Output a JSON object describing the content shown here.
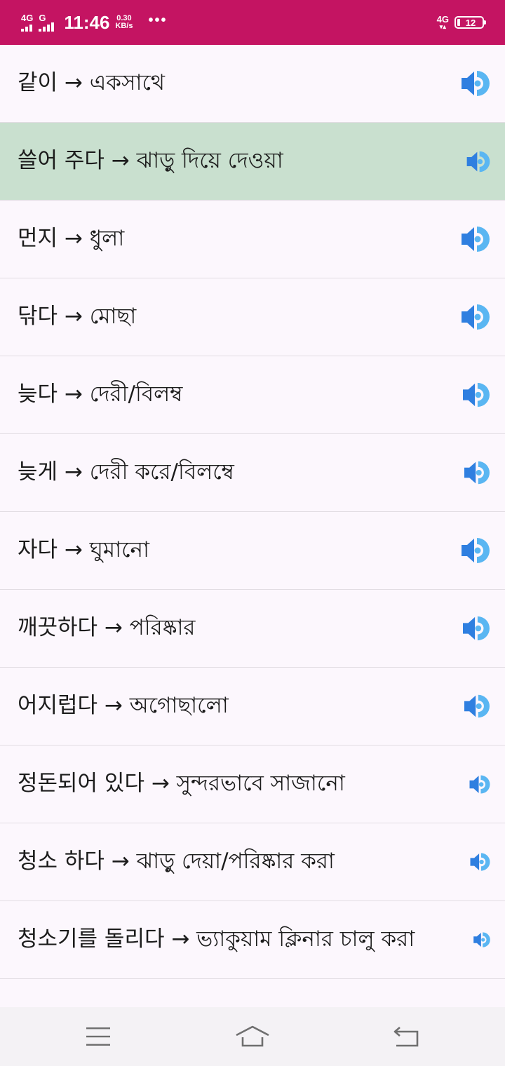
{
  "status_bar": {
    "sim1_network": "4G",
    "sim2_network": "G",
    "time": "11:46",
    "speed_value": "0.30",
    "speed_unit": "KB/s",
    "more": "•••",
    "right_network": "4G",
    "battery_level": "12",
    "color": "#c41462"
  },
  "phrases": [
    {
      "text": "같이 → একসাথে",
      "speaker_scale": 1.0
    },
    {
      "text": "쓸어 주다 → ঝাড়ু দিয়ে দেওয়া",
      "speaker_scale": 0.82,
      "highlighted": true
    },
    {
      "text": "먼지 → ধুলা",
      "speaker_scale": 1.0
    },
    {
      "text": "닦다 → মোছা",
      "speaker_scale": 1.0
    },
    {
      "text": "늦다 → দেরী/বিলম্ব",
      "speaker_scale": 0.95
    },
    {
      "text": "늦게 → দেরী করে/বিলম্বে",
      "speaker_scale": 0.9
    },
    {
      "text": "자다 → ঘুমানো",
      "speaker_scale": 1.0
    },
    {
      "text": "깨끗하다 → পরিষ্কার",
      "speaker_scale": 0.95
    },
    {
      "text": "어지럽다 → অগোছালো",
      "speaker_scale": 0.9
    },
    {
      "text": "정돈되어 있다 → সুন্দরভাবে সাজানো",
      "speaker_scale": 0.72
    },
    {
      "text": "청소 하다 → ঝাড়ু দেয়া/পরিষ্কার করা",
      "speaker_scale": 0.7
    },
    {
      "text": "청소기를 돌리다 → ভ্যাকুয়াম ক্লিনার চালু করা",
      "speaker_scale": 0.6
    }
  ],
  "colors": {
    "speaker_dark": "#2f7fe0",
    "speaker_light": "#5ab6f2",
    "highlight": "#c9e0cf"
  },
  "nav": {
    "menu_icon": "menu-icon",
    "home_icon": "home-icon",
    "back_icon": "back-icon"
  }
}
